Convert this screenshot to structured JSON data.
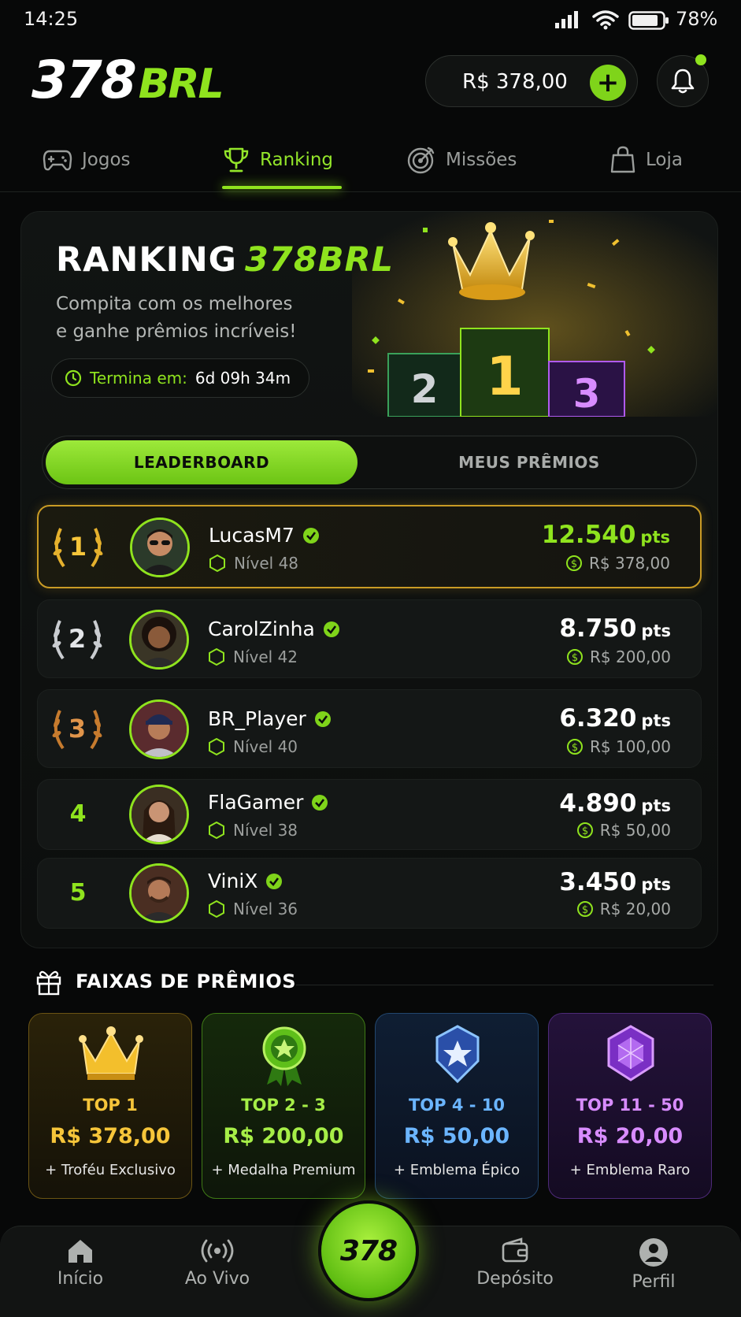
{
  "status_bar": {
    "time": "14:25",
    "battery": "78%"
  },
  "header": {
    "logo_main": "378",
    "logo_accent": "BRL",
    "balance": "R$ 378,00"
  },
  "tabs": [
    {
      "label": "Jogos",
      "icon": "gamepad-icon"
    },
    {
      "label": "Ranking",
      "icon": "trophy-icon",
      "active": true
    },
    {
      "label": "Missões",
      "icon": "target-icon"
    },
    {
      "label": "Loja",
      "icon": "shopping-bag-icon"
    }
  ],
  "hero": {
    "title": "RANKING",
    "title_accent": "378BRL",
    "subtitle_line1": "Compita com os melhores",
    "subtitle_line2": "e ganhe prêmios incríveis!",
    "timer_label": "Termina em:",
    "timer_value": "6d 09h 34m",
    "podium": [
      "2",
      "1",
      "3"
    ]
  },
  "segment": {
    "active": "LEADERBOARD",
    "inactive": "MEUS PRÊMIOS"
  },
  "leaderboard": [
    {
      "rank": "1",
      "name": "LucasM7",
      "level": "Nível 48",
      "points": "12.540",
      "unit": "pts",
      "prize": "R$ 378,00"
    },
    {
      "rank": "2",
      "name": "CarolZinha",
      "level": "Nível 42",
      "points": "8.750",
      "unit": "pts",
      "prize": "R$ 200,00"
    },
    {
      "rank": "3",
      "name": "BR_Player",
      "level": "Nível 40",
      "points": "6.320",
      "unit": "pts",
      "prize": "R$ 100,00"
    },
    {
      "rank": "4",
      "name": "FlaGamer",
      "level": "Nível 38",
      "points": "4.890",
      "unit": "pts",
      "prize": "R$ 50,00"
    },
    {
      "rank": "5",
      "name": "ViniX",
      "level": "Nível 36",
      "points": "3.450",
      "unit": "pts",
      "prize": "R$ 20,00"
    }
  ],
  "tiers_title": "FAIXAS DE PRÊMIOS",
  "tiers": [
    {
      "tier": "TOP 1",
      "amount": "R$ 378,00",
      "desc": "+ Troféu Exclusivo",
      "icon": "crown-icon"
    },
    {
      "tier": "TOP 2 - 3",
      "amount": "R$ 200,00",
      "desc": "+ Medalha Premium",
      "icon": "medal-icon"
    },
    {
      "tier": "TOP 4 - 10",
      "amount": "R$ 50,00",
      "desc": "+ Emblema Épico",
      "icon": "star-shield-icon"
    },
    {
      "tier": "TOP 11 - 50",
      "amount": "R$ 20,00",
      "desc": "+ Emblema Raro",
      "icon": "gem-icon"
    }
  ],
  "bottom_nav": [
    {
      "label": "Início",
      "icon": "home-icon"
    },
    {
      "label": "Ao Vivo",
      "icon": "broadcast-icon"
    },
    {
      "label": "378",
      "icon": "center-logo"
    },
    {
      "label": "Depósito",
      "icon": "wallet-icon"
    },
    {
      "label": "Perfil",
      "icon": "user-icon"
    }
  ],
  "colors": {
    "accent": "#8fe31e",
    "gold": "#f6c53a",
    "blue": "#6bb5ff",
    "purple": "#d88cff",
    "background": "#070808"
  }
}
